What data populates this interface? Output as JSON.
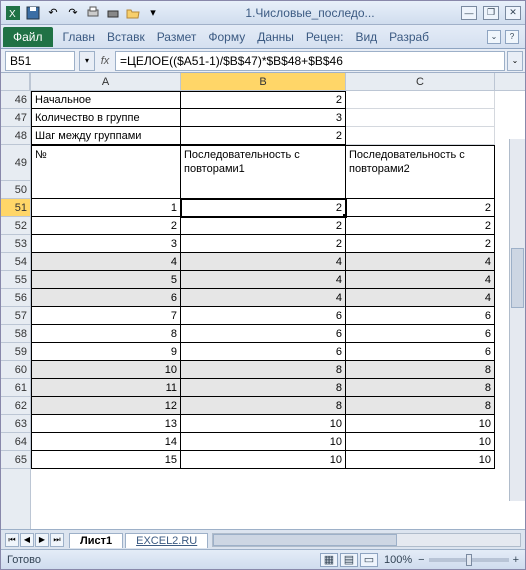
{
  "window": {
    "title": "1.Числовые_последо..."
  },
  "ribbon": {
    "file": "Файл",
    "tabs": [
      "Главн",
      "Вставк",
      "Размет",
      "Форму",
      "Данны",
      "Рецен:",
      "Вид",
      "Разраб"
    ]
  },
  "namebox": "B51",
  "fx_label": "fx",
  "formula": "=ЦЕЛОЕ(($A51-1)/$B$47)*$B$48+$B$46",
  "cols": [
    "A",
    "B",
    "C"
  ],
  "row_labels": [
    "46",
    "47",
    "48",
    "49",
    "50",
    "51",
    "52",
    "53",
    "54",
    "55",
    "56",
    "57",
    "58",
    "59",
    "60",
    "61",
    "62",
    "63",
    "64",
    "65"
  ],
  "labels": {
    "r46": "Начальное",
    "r47": "Количество в группе",
    "r48": "Шаг между группами",
    "r49a": "№",
    "r49b": "Последовательность с повторами1",
    "r49c": "Последовательность с повторами2"
  },
  "params": {
    "b46": "2",
    "b47": "3",
    "b48": "2"
  },
  "data": [
    {
      "n": "1",
      "b": "2",
      "c": "2"
    },
    {
      "n": "2",
      "b": "2",
      "c": "2"
    },
    {
      "n": "3",
      "b": "2",
      "c": "2"
    },
    {
      "n": "4",
      "b": "4",
      "c": "4"
    },
    {
      "n": "5",
      "b": "4",
      "c": "4"
    },
    {
      "n": "6",
      "b": "4",
      "c": "4"
    },
    {
      "n": "7",
      "b": "6",
      "c": "6"
    },
    {
      "n": "8",
      "b": "6",
      "c": "6"
    },
    {
      "n": "9",
      "b": "6",
      "c": "6"
    },
    {
      "n": "10",
      "b": "8",
      "c": "8"
    },
    {
      "n": "11",
      "b": "8",
      "c": "8"
    },
    {
      "n": "12",
      "b": "8",
      "c": "8"
    },
    {
      "n": "13",
      "b": "10",
      "c": "10"
    },
    {
      "n": "14",
      "b": "10",
      "c": "10"
    },
    {
      "n": "15",
      "b": "10",
      "c": "10"
    }
  ],
  "sheets": {
    "active": "Лист1",
    "link": "EXCEL2.RU"
  },
  "status": {
    "ready": "Готово",
    "zoom": "100%"
  }
}
